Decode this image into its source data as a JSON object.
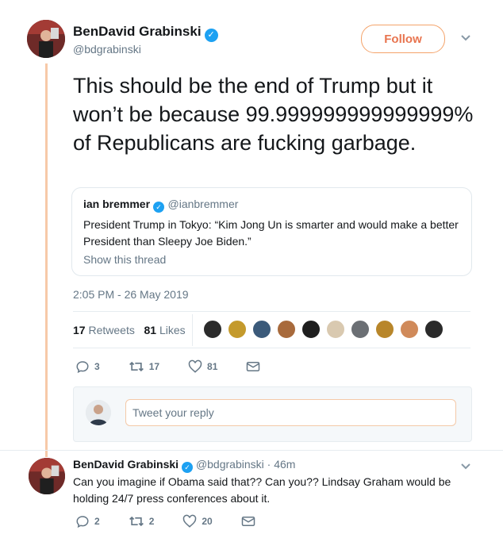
{
  "main_tweet": {
    "author_name": "BenDavid Grabinski",
    "author_handle": "@bdgrabinski",
    "follow_label": "Follow",
    "text": "This should be the end of Trump but it won’t be because 99.999999999999999% of Republicans are fucking garbage.",
    "timestamp": "2:05 PM - 26 May 2019",
    "retweets_count": "17",
    "retweets_label": "Retweets",
    "likes_count": "81",
    "likes_label": "Likes",
    "reply_count": "3",
    "retweet_action_count": "17",
    "like_action_count": "81"
  },
  "quoted_tweet": {
    "author_name": "ian bremmer",
    "author_handle": "@ianbremmer",
    "text": "President Trump in Tokyo: “Kim Jong Un is smarter and would make a better President than Sleepy Joe Biden.”",
    "show_thread": "Show this thread"
  },
  "reply_composer": {
    "placeholder": "Tweet your reply"
  },
  "reply_tweet": {
    "author_name": "BenDavid Grabinski",
    "author_handle": "@bdgrabinski",
    "separator": "·",
    "time": "46m",
    "text": "Can you imagine if Obama said that?? Can you?? Lindsay Graham would be holding 24/7 press conferences about it.",
    "reply_count": "2",
    "retweet_count": "2",
    "like_count": "20"
  },
  "colors": {
    "verified": "#1da1f2",
    "follow": "#e8744f",
    "thread_line": "#f7c9a8"
  },
  "likers": [
    "#2b2b2b",
    "#c49a2c",
    "#3b5a7a",
    "#a86a3c",
    "#1e1e1e",
    "#d9c9b0",
    "#6b6f74",
    "#b8862a",
    "#d08a5a",
    "#2a2a2a"
  ]
}
